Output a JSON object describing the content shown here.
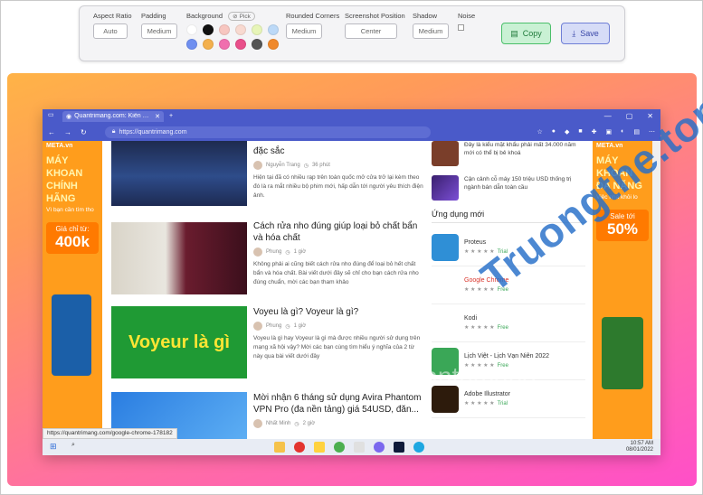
{
  "toolbar": {
    "aspect_ratio": {
      "label": "Aspect Ratio",
      "value": "Auto"
    },
    "padding": {
      "label": "Padding",
      "value": "Medium"
    },
    "background": {
      "label": "Background",
      "pick_label": "Pick",
      "swatches": [
        "#ffffff",
        "#111111",
        "#f7c6c0",
        "#f8d9d0",
        "#e7f5b8",
        "#bcd9f7",
        "#6f8ff0",
        "#f3b04d",
        "#f06fae",
        "#e94f8a",
        "#555555",
        "#f0892b"
      ]
    },
    "rounded_corners": {
      "label": "Rounded Corners",
      "value": "Medium"
    },
    "screenshot_position": {
      "label": "Screenshot Position",
      "value": "Center"
    },
    "shadow": {
      "label": "Shadow",
      "value": "Medium"
    },
    "noise": {
      "label": "Noise"
    },
    "copy_label": "Copy",
    "save_label": "Save"
  },
  "browser": {
    "tab_title": "Quantrimang.com: Kiến Thức Cô",
    "url": "https://quantrimang.com",
    "status_url": "https://quantrimang.com/google-chrome-178182"
  },
  "ads": {
    "left": {
      "brand": "META.vn",
      "headline": "MÁY KHOAN CHÍNH HÃNG",
      "sub": "Vì bạn cần tìm tho",
      "price_label": "Giá chỉ từ:",
      "price": "400k"
    },
    "right": {
      "brand": "META.vn",
      "headline": "MÁY KHOAN ĐA NĂNG",
      "sub": "Việc nhà khỏi lo",
      "price_label": "Sale tới",
      "price": "50%"
    }
  },
  "articles": [
    {
      "title": "đặc sắc",
      "author": "Nguyễn Trang",
      "time": "36 phút",
      "desc": "Hiện tại đã có nhiều rạp trên toàn quốc mở cửa trở lại kèm theo đó là ra mắt nhiều bộ phim mới, hấp dẫn tới người yêu thích điện ảnh."
    },
    {
      "title": "Cách rửa nho đúng giúp loại bỏ chất bẩn và hóa chất",
      "author": "Phung",
      "time": "1 giờ",
      "desc": "Không phải ai cũng biết cách rửa nho đúng để loại bỏ hết chất bẩn và hóa chất. Bài viết dưới đây sẽ chỉ cho bạn cách rửa nho đúng chuẩn, mời các bạn tham khảo"
    },
    {
      "title": "Voyeu là gì? Voyeur là gì?",
      "thumb_text": "Voyeur là gì",
      "author": "Phung",
      "time": "1 giờ",
      "desc": "Voyeu là gì hay Voyeur là gì mà được nhiều người sử dụng trên mạng xã hội vậy? Mời các bạn cùng tìm hiểu ý nghĩa của 2 từ này qua bài viết dưới đây"
    },
    {
      "title": "Mời nhận 6 tháng sử dụng Avira Phantom VPN Pro (đa nền tảng) giá 54USD, đăn...",
      "author": "Nhất Minh",
      "time": "2 giờ",
      "desc": ""
    }
  ],
  "sidebar": {
    "news": [
      {
        "text": "Đây là kiểu mặt khẩu phải mất 34.000 năm mới có thể bị bẻ khoá"
      },
      {
        "text": "Cận cảnh cỗ máy 150 triệu USD thống trị ngành bán dẫn toàn cầu"
      }
    ],
    "apps_title": "Ứng dụng mới",
    "apps": [
      {
        "name": "Proteus",
        "tag": "Trial",
        "color": "#2f8fd6"
      },
      {
        "name": "Google Chrome",
        "tag": "Free",
        "color": "#ffffff"
      },
      {
        "name": "Kodi",
        "tag": "Free",
        "color": "#ffffff"
      },
      {
        "name": "Lịch Việt - Lịch Vạn Niên 2022",
        "tag": "Free",
        "color": "#3aa757"
      },
      {
        "name": "Adobe Illustrator",
        "tag": "Trial",
        "color": "#2d1b0c"
      }
    ]
  },
  "taskbar": {
    "time": "10:57 AM",
    "date": "08/01/2022"
  },
  "watermark": "Truongthe.top",
  "watermark2": "Quantrimang"
}
